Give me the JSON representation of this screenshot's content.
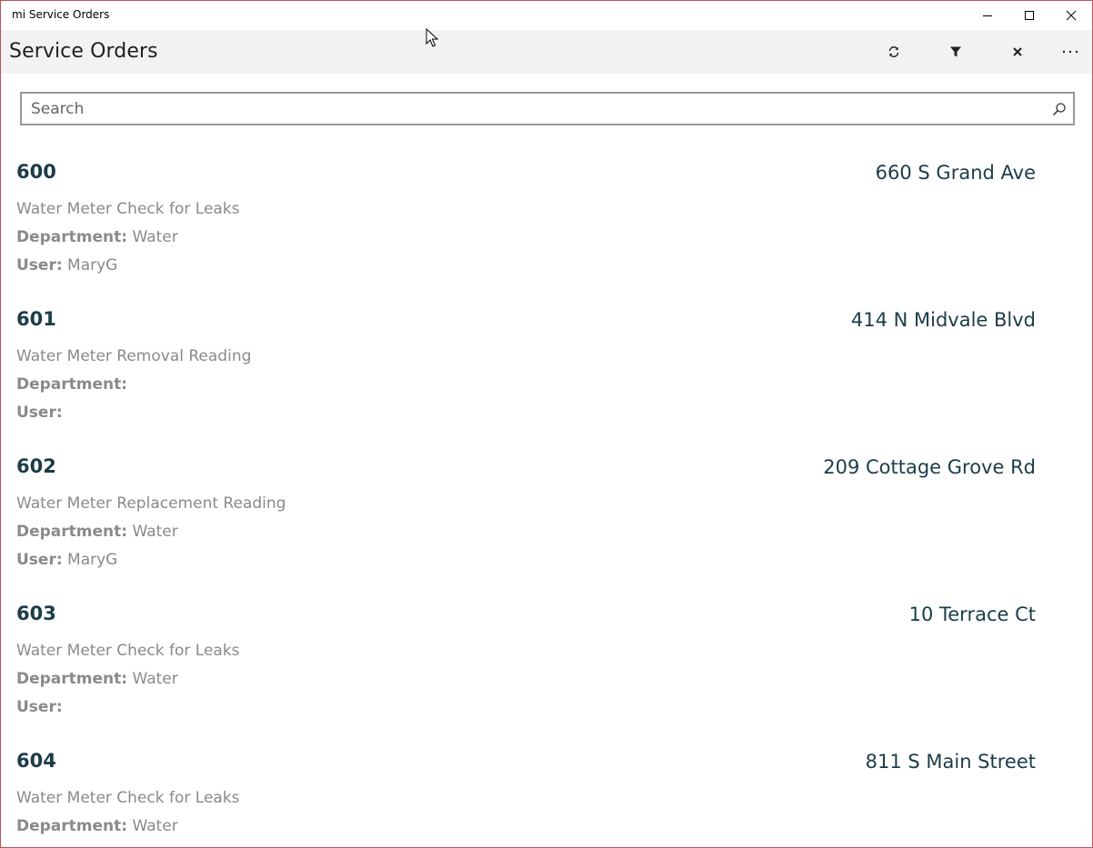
{
  "window": {
    "title": "mi Service Orders",
    "controls": {
      "minimize": "minimize-icon",
      "maximize": "maximize-icon",
      "close": "close-icon"
    }
  },
  "header": {
    "title": "Service Orders",
    "commands": [
      {
        "name": "refresh",
        "icon": "refresh-icon"
      },
      {
        "name": "filter",
        "icon": "filter-icon"
      },
      {
        "name": "clear",
        "icon": "close-icon"
      },
      {
        "name": "more",
        "icon": "more-icon"
      }
    ]
  },
  "search": {
    "placeholder": "Search",
    "value": "",
    "icon": "search-icon"
  },
  "labels": {
    "department": "Department:",
    "user": "User:"
  },
  "orders": [
    {
      "number": "600",
      "address": "660 S Grand Ave",
      "description": "Water Meter Check for Leaks",
      "department": "Water",
      "user": "MaryG"
    },
    {
      "number": "601",
      "address": "414 N Midvale Blvd",
      "description": "Water Meter Removal Reading",
      "department": "",
      "user": ""
    },
    {
      "number": "602",
      "address": "209 Cottage Grove Rd",
      "description": "Water Meter Replacement Reading",
      "department": "Water",
      "user": "MaryG"
    },
    {
      "number": "603",
      "address": "10 Terrace Ct",
      "description": "Water Meter Check for Leaks",
      "department": "Water",
      "user": ""
    },
    {
      "number": "604",
      "address": "811 S Main Street",
      "description": "Water Meter Check for Leaks",
      "department": "Water",
      "user": ""
    }
  ],
  "colors": {
    "window_border": "#c4505a",
    "command_bar": "#f2f2f2",
    "order_heading": "#1c3c48",
    "secondary_text": "#8a8a8a"
  }
}
